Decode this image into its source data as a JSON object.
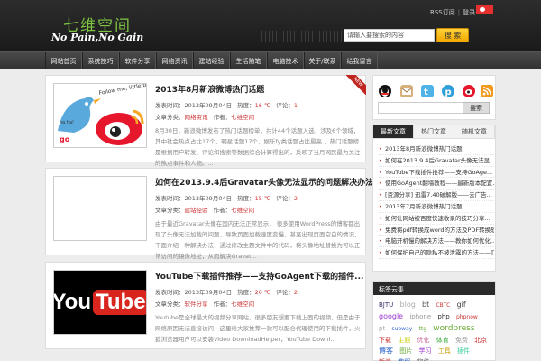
{
  "header": {
    "logo_title": "七维空间",
    "slogan": "No Pain,No Gain",
    "top_links": [
      "RSS订阅",
      "登录"
    ],
    "search_placeholder": "请输入要搜索的内容",
    "search_button": "搜 索"
  },
  "nav": [
    "网站首页",
    "系统技巧",
    "软件分享",
    "网络资讯",
    "建站经验",
    "生活随笔",
    "电脑技术",
    "关于/联系",
    "给我留言"
  ],
  "posts": [
    {
      "title": "2013年8月新浪微博热门话题",
      "date": "发表时间：2013年09月04日",
      "views_label": "热度：",
      "views": "16 ℃",
      "comments_label": "评论：",
      "comments": "1",
      "category_label": "文章分类：",
      "category": "网络资讯",
      "author_label": "作者：",
      "author": "七维空间",
      "excerpt": "8月30日，新浪微博发布了热门话题榜单，共计44个话题入选，涉及6个领域，其中社会热点占比17个，明星话题17个，娱乐fy类话题占比最高 ，热门话题榜是根据用户转发、评论和搜索等数据综合计算得出的，反映了当月网民最为关注的热点事件和人物。...",
      "thumb": "weibo",
      "ribbon": "NEW"
    },
    {
      "title": "如何在2013.9.4后Gravatar头像无法显示的问题解决办法...",
      "date": "发表时间：2013年09月04日",
      "views_label": "热度：",
      "views": "15 ℃",
      "comments_label": "评论：",
      "comments": "2",
      "category_label": "文章分类：",
      "category": "建站经验",
      "author_label": "作者：",
      "author": "七维空间",
      "excerpt": "由于最近Gravatar头像在国内无法正常显示， 很多使用WordPress的博客都出现了头像无法加载的问题，导致页面加载速度变慢，甚至出现页面空白的情况，下面介绍一种解决办法，通过修改主题文件中的代码，将头像地址替换为可以正常访问的镜像地址，从而解决Gravat...",
      "thumb": "blank"
    },
    {
      "title": "YouTube下载插件推荐——支持GoAgent下载的插件...",
      "date": "发表时间：2013年09月04日",
      "views_label": "热度：",
      "views": "20 ℃",
      "comments_label": "评论：",
      "comments": "2",
      "category_label": "文章分类：",
      "category": "软件分享",
      "author_label": "作者：",
      "author": "七维空间",
      "excerpt": "Youtube是全球最大的视频分享网站，很多朋友想要下载上面的视频，但是由于网络原因无法直接访问，这里给大家推荐一款可以配合代理使用的下载插件，火狐浏览器用户可以安装Video DownloadHelper，YouTube Downl...",
      "thumb": "youtube",
      "thumb_text_1": "You",
      "thumb_text_2": "Tube"
    }
  ],
  "sidebar": {
    "search_button": "搜索",
    "tabs": [
      "最新文章",
      "热门文章",
      "随机文章"
    ],
    "recent": [
      "2013年8月新浪微博热门话题",
      "如何在2013.9.4后Gravatar头像无法显...",
      "YouTube下载插件推荐——支持GoAge...",
      "使用GoAgent翻墙教程——最新版本配置...",
      "[资源分享] 迅雷7.40破解版——去广告...",
      "2013年7月新浪微博热门话题",
      "如何让网站被百度快速收录的技巧分享...",
      "免费将pdf转换成word的方法及PDF转换软件",
      "电脑开机慢的解决方法——教你如何优化...",
      "如何保护自己的隐私不被泄露的方法——T..."
    ],
    "tags_title": "标签云集",
    "tags": [
      "BJTU",
      "blog",
      "bt",
      "CBTC",
      "gif",
      "google",
      "iphone",
      "php",
      "phpnow",
      "pt",
      "subway",
      "ttg",
      "wordpress",
      "下载",
      "主题",
      "优化",
      "体育",
      "免费",
      "北京",
      "博客",
      "图片",
      "学习",
      "工具",
      "插件",
      "新浪",
      "教程",
      "软件"
    ]
  },
  "colors": {
    "accent_green": "#7fc542",
    "accent_red": "#c33",
    "search_yellow": "#f5b800"
  }
}
